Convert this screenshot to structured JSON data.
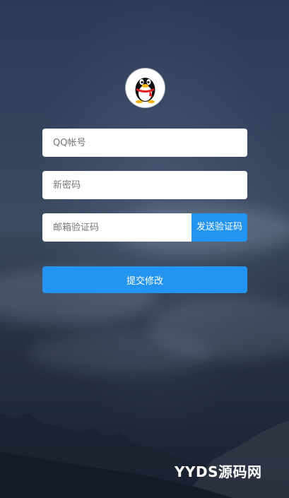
{
  "form": {
    "qq_account_placeholder": "QQ帐号",
    "new_password_placeholder": "新密码",
    "email_code_placeholder": "邮箱验证码",
    "send_code_label": "发送验证码",
    "submit_label": "提交修改"
  },
  "watermark": {
    "text": "YYDS源码网"
  },
  "colors": {
    "accent": "#2395f0",
    "background_top": "#2b3a55",
    "background_bottom": "#1a2232",
    "field_background": "#ffffff"
  },
  "icons": {
    "avatar": "qq-penguin-icon"
  }
}
